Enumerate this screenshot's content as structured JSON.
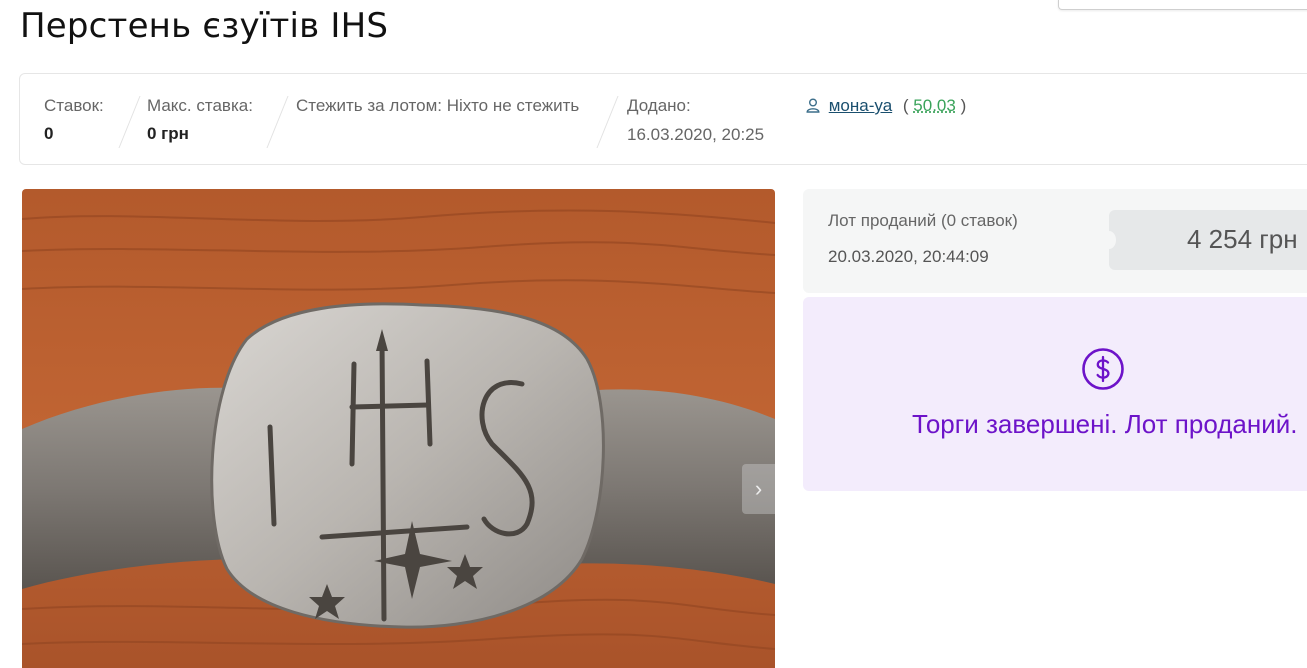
{
  "lot": {
    "title": "Перстень єзуїтів IHS"
  },
  "stats": {
    "bids_label": "Ставок:",
    "bids_value": "0",
    "max_bid_label": "Макс. ставка:",
    "max_bid_value": "0 грн",
    "watch_text": "Стежить за лотом: Ніхто не стежить",
    "added_label": "Додано:",
    "added_value": "16.03.2020, 20:25"
  },
  "seller": {
    "icon": "user-icon",
    "name": "мона-уа",
    "paren_open": "(",
    "rating": "50.03",
    "paren_close": ")"
  },
  "photo": {
    "description_icon": "photo-of-ring",
    "next_arrow": "›"
  },
  "sale": {
    "status": "Лот проданий (0 ставок)",
    "date": "20.03.2020, 20:44:09",
    "price": "4 254 грн"
  },
  "auction_end": {
    "icon": "dollar-circle-icon",
    "message": "Торги завершені. Лот проданий."
  },
  "colors": {
    "accent_purple": "#6d13c9",
    "panel_purple_bg": "#f3ecfc",
    "rating_green": "#3aa35a",
    "link_blue": "#1a4f6e"
  }
}
